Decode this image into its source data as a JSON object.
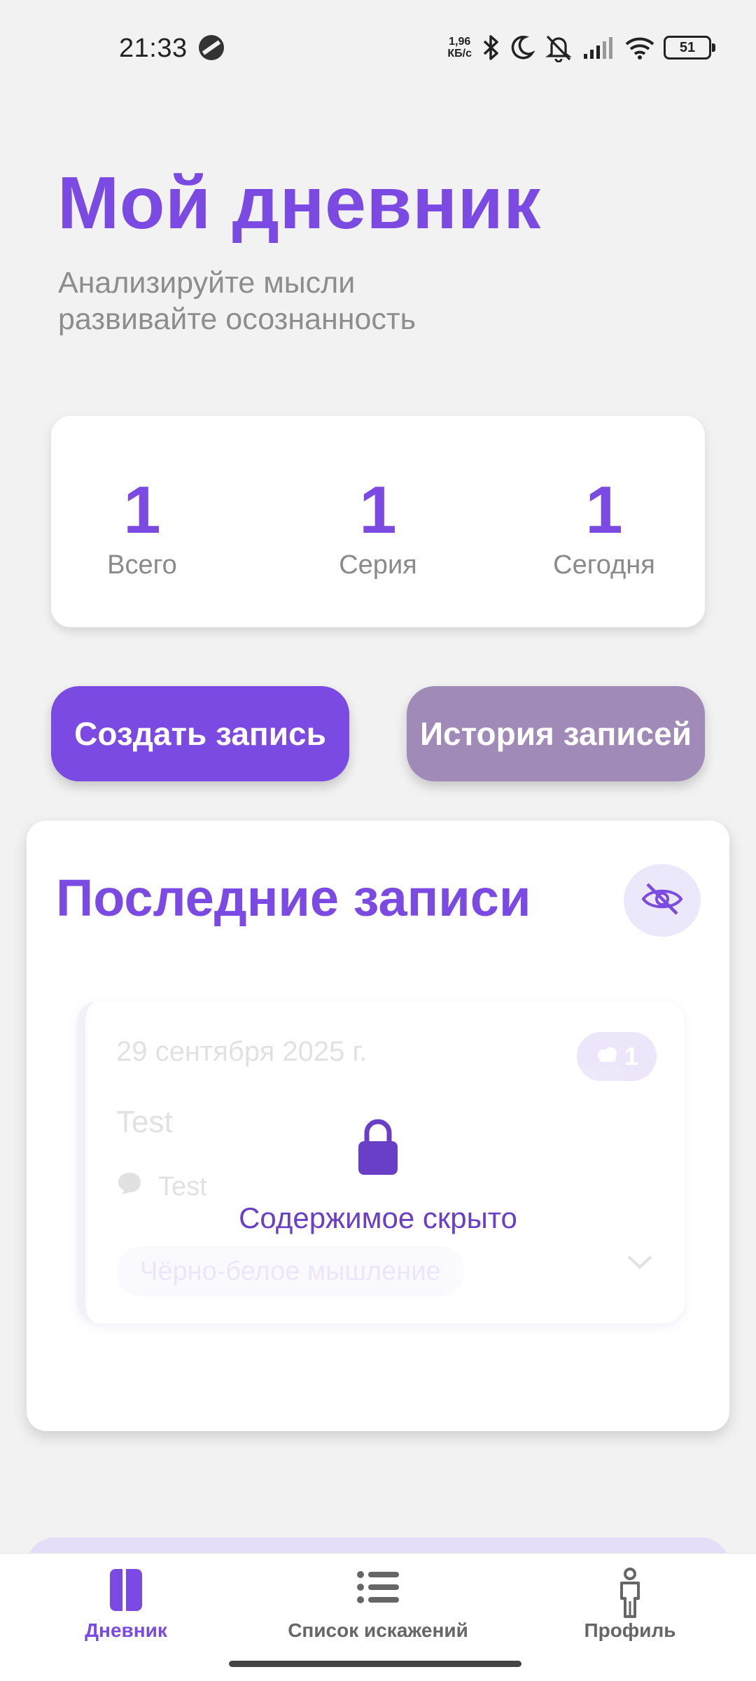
{
  "status_bar": {
    "time": "21:33",
    "speed_value": "1,96",
    "speed_unit": "КБ/с",
    "battery": "51",
    "icons": [
      "bluetooth-icon",
      "moon-icon",
      "mute-icon",
      "signal-icon",
      "wifi-icon",
      "battery-icon"
    ]
  },
  "header": {
    "title": "Мой дневник",
    "subtitle_line1": "Анализируйте мысли",
    "subtitle_line2": "развивайте осознанность"
  },
  "stats": [
    {
      "value": "1",
      "label": "Всего"
    },
    {
      "value": "1",
      "label": "Серия"
    },
    {
      "value": "1",
      "label": "Сегодня"
    }
  ],
  "actions": {
    "create": "Создать запись",
    "history": "История записей"
  },
  "recent": {
    "title": "Последние записи",
    "entry": {
      "date": "29 сентября 2025 г.",
      "badge_count": "1",
      "title": "Test",
      "thought": "Test",
      "tag": "Чёрно-белое мышление"
    },
    "hidden_label": "Содержимое скрыто"
  },
  "nav": {
    "items": [
      {
        "label": "Дневник",
        "active": true
      },
      {
        "label": "Список искажений",
        "active": false
      },
      {
        "label": "Профиль",
        "active": false
      }
    ]
  },
  "colors": {
    "accent": "#7b4ae2",
    "secondary_button": "#a08bb8",
    "background": "#f2f2f2",
    "muted_text": "#8d8d8d"
  }
}
